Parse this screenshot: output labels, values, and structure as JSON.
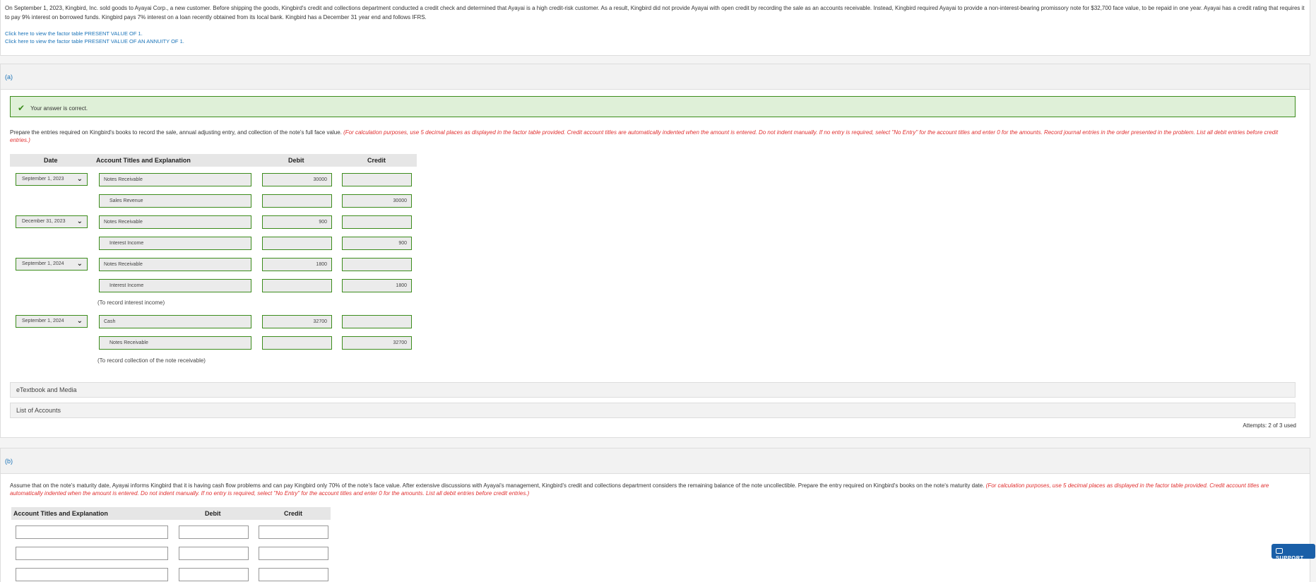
{
  "problem": {
    "text": "On September 1, 2023, Kingbird, Inc. sold goods to Ayayai Corp., a new customer. Before shipping the goods, Kingbird's credit and collections department conducted a credit check and determined that Ayayai is a high credit-risk customer. As a result, Kingbird did not provide Ayayai with open credit by recording the sale as an accounts receivable. Instead, Kingbird required Ayayai to provide a non-interest-bearing promissory note for $32,700 face value, to be repaid in one year. Ayayai has a credit rating that requires it to pay 9% interest on borrowed funds. Kingbird pays 7% interest on a loan recently obtained from its local bank. Kingbird has a December 31 year end and follows IFRS.",
    "link_pv1": "Click here to view the factor table PRESENT VALUE OF 1.",
    "link_pva1": "Click here to view the factor table PRESENT VALUE OF AN ANNUITY OF 1."
  },
  "part_a": {
    "label": "(a)",
    "correct_msg": "Your answer is correct.",
    "instr_main": "Prepare the entries required on Kingbird's books to record the sale, annual adjusting entry, and collection of the note's full face value.",
    "instr_red": "(For calculation purposes, use 5 decimal places as displayed in the factor table provided. Credit account titles are automatically indented when the amount is entered. Do not indent manually. If no entry is required, select \"No Entry\" for the account titles and enter 0 for the amounts. Record journal entries in the order presented in the problem. List all debit entries before credit entries.)",
    "headers": {
      "date": "Date",
      "account": "Account Titles and Explanation",
      "debit": "Debit",
      "credit": "Credit"
    },
    "rows": [
      {
        "date": "September 1, 2023",
        "account": "Notes Receivable",
        "debit": "30000",
        "credit": ""
      },
      {
        "date": "",
        "account": "Sales Revenue",
        "debit": "",
        "credit": "30000"
      },
      {
        "date": "December 31, 2023",
        "account": "Notes Receivable",
        "debit": "900",
        "credit": ""
      },
      {
        "date": "",
        "account": "Interest Income",
        "debit": "",
        "credit": "900"
      },
      {
        "date": "September 1, 2024",
        "account": "Notes Receivable",
        "debit": "1800",
        "credit": ""
      },
      {
        "date": "",
        "account": "Interest Income",
        "debit": "",
        "credit": "1800"
      },
      {
        "date": "September 1, 2024",
        "account": "Cash",
        "debit": "32700",
        "credit": ""
      },
      {
        "date": "",
        "account": "Notes Receivable",
        "debit": "",
        "credit": "32700"
      }
    ],
    "memo1": "(To record interest income)",
    "memo2": "(To record collection of the note receivable)",
    "etextbook": "eTextbook and Media",
    "list_accounts": "List of Accounts",
    "attempts": "Attempts: 2 of 3 used"
  },
  "part_b": {
    "label": "(b)",
    "instr_main": "Assume that on the note's maturity date, Ayayai informs Kingbird that it is having cash flow problems and can pay Kingbird only 70% of the note's face value. After extensive discussions with Ayayai's management, Kingbird's credit and collections department considers the remaining balance of the note uncollectible. Prepare the entry required on Kingbird's books on the note's maturity date.",
    "instr_red": "(For calculation purposes, use 5 decimal places as displayed in the factor table provided. Credit account titles are automatically indented when the amount is entered. Do not indent manually. If no entry is required, select \"No Entry\" for the account titles and enter 0 for the amounts. List all debit entries before credit entries.)",
    "headers": {
      "account": "Account Titles and Explanation",
      "debit": "Debit",
      "credit": "Credit"
    }
  },
  "support": {
    "label": "SUPPORT"
  }
}
